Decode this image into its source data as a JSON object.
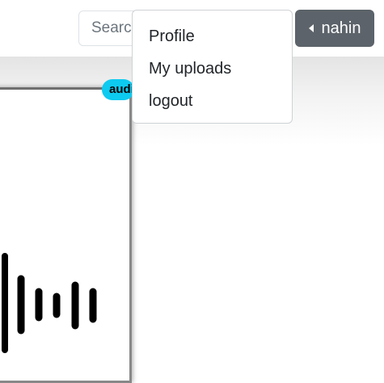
{
  "header": {
    "search": {
      "placeholder": "Search"
    },
    "user_button": {
      "label": "nahin",
      "icon": "caret-left-icon"
    }
  },
  "user_menu": {
    "items": [
      {
        "label": "Profile"
      },
      {
        "label": "My uploads"
      },
      {
        "label": "logout"
      }
    ]
  },
  "media_card": {
    "badge": "audio",
    "thumbnail_icon": "audio-waveform-icon",
    "badge_color": "#0dcaf0"
  },
  "colors": {
    "user_button_bg": "#5c636a",
    "text": "#212529"
  }
}
